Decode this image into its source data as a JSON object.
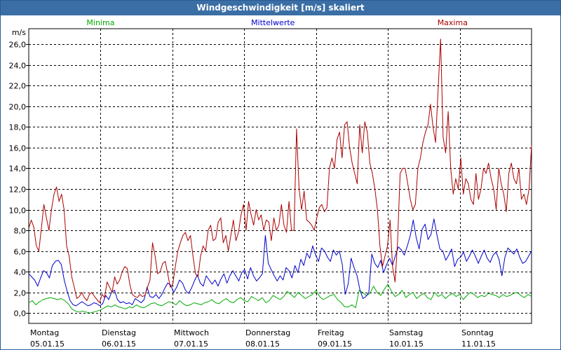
{
  "window": {
    "title": "Windgeschwindigkeit [m/s] skaliert"
  },
  "chart_data": {
    "type": "line",
    "title": "Windgeschwindigkeit [m/s] skaliert",
    "ylabel": "m/s",
    "xlabel": "",
    "ylim": [
      -1.0,
      27.5
    ],
    "xlim": [
      0,
      7
    ],
    "yticks": [
      0,
      2,
      4,
      6,
      8,
      10,
      12,
      14,
      16,
      18,
      20,
      22,
      24,
      26
    ],
    "ytick_labels": [
      "0,0",
      "2,0",
      "4,0",
      "6,0",
      "8,0",
      "10,0",
      "12,0",
      "14,0",
      "16,0",
      "18,0",
      "20,0",
      "22,0",
      "24,0",
      "26,0"
    ],
    "grid": true,
    "day_labels": [
      {
        "day": "Montag",
        "date": "05.01.15"
      },
      {
        "day": "Dienstag",
        "date": "06.01.15"
      },
      {
        "day": "Mittwoch",
        "date": "07.01.15"
      },
      {
        "day": "Donnerstag",
        "date": "08.01.15"
      },
      {
        "day": "Freitag",
        "date": "09.01.15"
      },
      {
        "day": "Samstag",
        "date": "10.01.15"
      },
      {
        "day": "Sonntag",
        "date": "11.01.15"
      }
    ],
    "legend_position": "top",
    "series": [
      {
        "name": "Minima",
        "color": "#00aa00",
        "step": 0.05,
        "values": [
          1.0,
          1.2,
          0.8,
          1.1,
          1.3,
          1.4,
          1.5,
          1.4,
          1.3,
          1.4,
          1.2,
          0.9,
          0.4,
          0.2,
          0.1,
          0.2,
          0.1,
          0.0,
          0.1,
          0.2,
          0.3,
          0.5,
          0.7,
          0.6,
          0.8,
          0.6,
          0.5,
          0.4,
          0.6,
          0.5,
          0.8,
          0.6,
          0.5,
          0.7,
          0.9,
          1.0,
          0.8,
          0.7,
          0.9,
          1.1,
          1.0,
          0.8,
          1.2,
          0.9,
          0.7,
          0.8,
          1.0,
          0.9,
          0.8,
          1.0,
          1.1,
          1.3,
          1.0,
          0.9,
          1.2,
          1.4,
          1.1,
          1.0,
          1.3,
          1.5,
          1.2,
          1.1,
          1.6,
          1.4,
          1.2,
          1.5,
          1.0,
          1.2,
          1.7,
          1.5,
          1.3,
          1.6,
          2.1,
          1.8,
          1.5,
          2.0,
          1.7,
          1.4,
          1.6,
          1.8,
          2.2,
          1.6,
          1.3,
          1.5,
          1.7,
          1.8,
          1.3,
          1.0,
          0.6,
          0.6,
          0.8,
          0.5,
          2.2,
          2.0,
          1.7,
          1.9,
          2.6,
          2.0,
          1.7,
          2.3,
          2.8,
          2.1,
          1.6,
          1.8,
          2.2,
          1.5,
          1.8,
          2.0,
          1.4,
          1.7,
          1.9,
          1.5,
          1.3,
          2.0,
          1.6,
          1.8,
          1.4,
          1.7,
          1.9,
          1.6,
          1.8,
          1.3,
          1.7,
          2.0,
          1.8,
          1.5,
          1.7,
          1.6,
          1.9,
          1.8,
          1.7,
          1.5,
          1.8,
          1.6,
          1.7,
          1.9,
          2.0,
          1.7,
          1.5,
          1.8,
          1.6
        ]
      },
      {
        "name": "Mittelwerte",
        "color": "#0000cc",
        "step": 0.05,
        "values": [
          3.8,
          3.5,
          3.2,
          2.6,
          3.4,
          4.1,
          3.9,
          3.4,
          4.6,
          5.0,
          5.1,
          4.7,
          3.2,
          2.1,
          1.2,
          0.8,
          0.7,
          0.9,
          1.1,
          0.9,
          0.7,
          0.8,
          1.0,
          0.9,
          0.7,
          0.9,
          1.7,
          1.3,
          2.0,
          2.2,
          1.3,
          1.0,
          1.1,
          0.9,
          1.0,
          0.8,
          1.4,
          1.2,
          1.0,
          1.3,
          2.5,
          1.6,
          1.5,
          1.8,
          1.4,
          1.8,
          2.4,
          2.9,
          2.7,
          2.0,
          2.5,
          3.2,
          2.9,
          2.2,
          1.9,
          2.4,
          3.1,
          3.7,
          2.9,
          2.6,
          3.6,
          3.2,
          2.8,
          3.2,
          2.6,
          3.3,
          3.8,
          2.9,
          3.6,
          4.1,
          3.6,
          3.1,
          3.9,
          4.2,
          3.3,
          4.4,
          3.6,
          3.1,
          3.4,
          3.8,
          7.5,
          4.8,
          4.2,
          3.6,
          3.1,
          3.6,
          3.2,
          4.4,
          4.1,
          3.4,
          4.6,
          3.9,
          5.2,
          4.6,
          5.8,
          5.3,
          6.5,
          5.6,
          5.0,
          6.3,
          6.0,
          5.4,
          5.0,
          6.1,
          5.6,
          6.0,
          4.7,
          1.8,
          2.8,
          5.3,
          4.4,
          3.6,
          2.2,
          1.4,
          1.6,
          2.0,
          5.7,
          4.8,
          4.4,
          5.1,
          3.9,
          4.7,
          5.3,
          4.6,
          5.6,
          6.4,
          6.1,
          5.6,
          6.5,
          7.5,
          9.0,
          7.3,
          6.2,
          8.1,
          8.6,
          7.1,
          7.6,
          9.1,
          7.6,
          6.2,
          6.0,
          5.1,
          5.6,
          6.2,
          4.5,
          5.2,
          5.4,
          5.9,
          5.0,
          5.5,
          6.1,
          5.5,
          4.8,
          5.5,
          6.1,
          5.3,
          4.9,
          5.6,
          5.9,
          5.2,
          3.6,
          5.4,
          6.3,
          6.0,
          5.7,
          6.2,
          5.4,
          4.8,
          5.0,
          5.5,
          6.0
        ]
      },
      {
        "name": "Maxima",
        "color": "#aa0000",
        "step": 0.05,
        "values": [
          8.2,
          9.0,
          8.3,
          6.5,
          6.0,
          8.2,
          10.5,
          9.2,
          8.0,
          10.0,
          11.5,
          12.2,
          10.8,
          11.5,
          10.0,
          6.5,
          5.5,
          3.5,
          2.5,
          1.4,
          1.6,
          2.0,
          1.5,
          1.2,
          1.8,
          2.0,
          1.6,
          1.3,
          1.0,
          1.8,
          1.5,
          3.0,
          2.5,
          2.0,
          3.5,
          2.8,
          3.2,
          4.0,
          4.5,
          4.3,
          2.8,
          1.8,
          1.6,
          1.5,
          1.8,
          1.6,
          1.7,
          2.5,
          3.2,
          6.8,
          5.5,
          3.8,
          4.0,
          4.8,
          5.0,
          3.8,
          2.5,
          2.8,
          4.5,
          6.0,
          6.8,
          7.5,
          7.8,
          7.0,
          7.5,
          5.5,
          3.8,
          3.5,
          5.5,
          6.5,
          6.0,
          8.0,
          8.5,
          7.0,
          7.2,
          8.8,
          9.2,
          6.8,
          7.5,
          6.0,
          7.5,
          9.0,
          7.0,
          7.8,
          9.5,
          10.5,
          8.0,
          10.8,
          9.5,
          8.5,
          10.0,
          9.0,
          9.5,
          8.0,
          9.0,
          8.8,
          7.0,
          9.2,
          8.0,
          8.5,
          10.5,
          8.5,
          7.8,
          10.8,
          8.0,
          8.0,
          17.8,
          12.0,
          10.0,
          11.8,
          9.0,
          8.8,
          8.5,
          8.0,
          9.2,
          10.2,
          10.5,
          9.8,
          10.2,
          14.0,
          15.0,
          14.0,
          16.8,
          17.5,
          15.0,
          18.2,
          18.5,
          16.0,
          14.5,
          13.5,
          12.5,
          18.2,
          15.5,
          18.5,
          17.5,
          14.5,
          13.5,
          12.0,
          10.0,
          6.5,
          4.5,
          5.5,
          6.5,
          9.0,
          4.5,
          3.0,
          7.0,
          13.5,
          14.0,
          14.0,
          12.5,
          11.0,
          10.0,
          10.5,
          14.0,
          15.0,
          16.5,
          17.5,
          18.2,
          20.2,
          18.0,
          16.5,
          21.5,
          26.5,
          17.0,
          15.5,
          19.5,
          14.0,
          11.5,
          13.0,
          12.0,
          15.0,
          11.5,
          13.0,
          12.5,
          11.0,
          10.5,
          13.5,
          11.0,
          12.0,
          14.0,
          13.5,
          14.5,
          13.0,
          12.0,
          10.0,
          14.0,
          12.5,
          11.5,
          9.8,
          13.5,
          14.5,
          13.0,
          12.5,
          14.0,
          11.0,
          11.5,
          10.5,
          12.0,
          16.2
        ]
      }
    ]
  }
}
